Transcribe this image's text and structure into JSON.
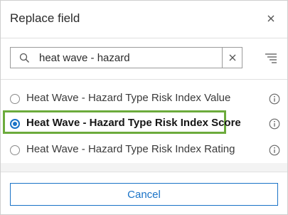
{
  "header": {
    "title": "Replace field",
    "close_icon": "close-icon"
  },
  "search": {
    "value": "heat wave - hazard",
    "search_icon": "search-icon",
    "clear_icon": "clear-x-icon",
    "filter_icon": "filter-list-icon"
  },
  "fields": [
    {
      "label": "Heat Wave - Hazard Type Risk Index Value",
      "selected": false
    },
    {
      "label": "Heat Wave - Hazard Type Risk Index Score",
      "selected": true
    },
    {
      "label": "Heat Wave - Hazard Type Risk Index Rating",
      "selected": false
    }
  ],
  "footer": {
    "cancel_label": "Cancel"
  },
  "colors": {
    "accent": "#1a73c7",
    "highlight": "#6cab3c"
  }
}
